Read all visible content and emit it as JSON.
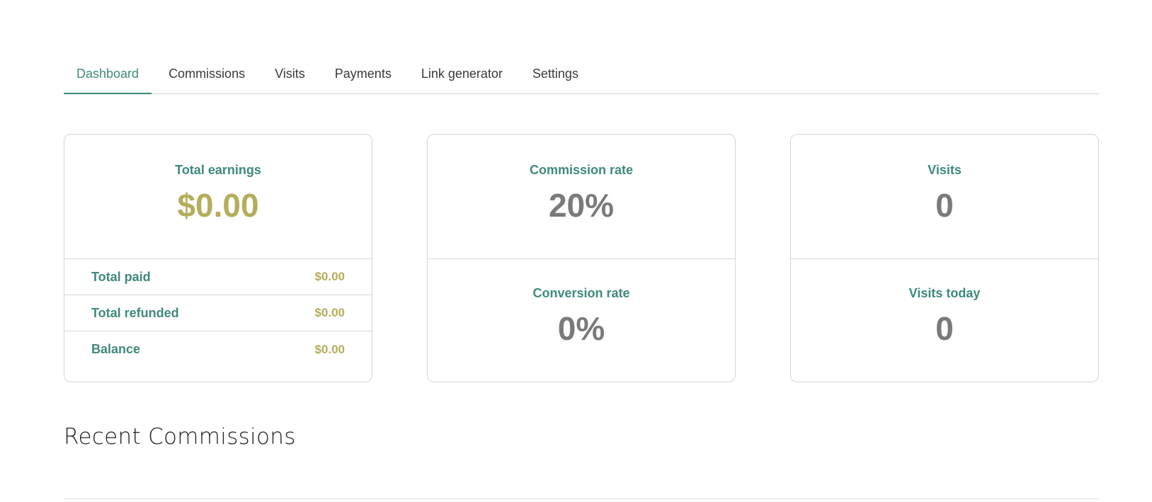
{
  "tabs": [
    {
      "label": "Dashboard",
      "active": true
    },
    {
      "label": "Commissions",
      "active": false
    },
    {
      "label": "Visits",
      "active": false
    },
    {
      "label": "Payments",
      "active": false
    },
    {
      "label": "Link generator",
      "active": false
    },
    {
      "label": "Settings",
      "active": false
    }
  ],
  "earnings": {
    "label": "Total earnings",
    "value": "$0.00",
    "details": [
      {
        "label": "Total paid",
        "value": "$0.00"
      },
      {
        "label": "Total refunded",
        "value": "$0.00"
      },
      {
        "label": "Balance",
        "value": "$0.00"
      }
    ]
  },
  "rates": {
    "commission_label": "Commission rate",
    "commission_value": "20%",
    "conversion_label": "Conversion rate",
    "conversion_value": "0%"
  },
  "visits": {
    "visits_label": "Visits",
    "visits_value": "0",
    "today_label": "Visits today",
    "today_value": "0"
  },
  "recent": {
    "title": "Recent Commissions"
  },
  "colors": {
    "accent": "#3f8a7e",
    "money": "#b4ad5a",
    "stat": "#7a7a7a",
    "border": "#d6d6d6"
  }
}
